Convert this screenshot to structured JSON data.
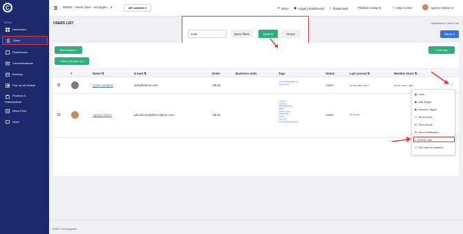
{
  "app": {
    "logo_letter": "C",
    "tenant_selector": "DEMO - Home Care - enCapptu... ▾",
    "admins_label": "MP ADMINS ▾",
    "inbox_label": "Inbox",
    "legacy_dashboard_label": "Legacy Dashboard",
    "downloads_label": "Downloads",
    "platform_setup_label": "Platform Setup ▾",
    "help_center_label": "Help Center",
    "user_label": "Agency Owner ▾"
  },
  "sidebar": {
    "menu_label": "MENU",
    "items": [
      {
        "label": "Dashboard",
        "icon": "dashboard-icon"
      },
      {
        "label": "Users",
        "icon": "user-icon"
      },
      {
        "label": "Experiences",
        "icon": "experiences-icon"
      },
      {
        "label": "Communications",
        "icon": "communications-icon"
      },
      {
        "label": "Booking",
        "icon": "booking-icon"
      },
      {
        "label": "Pop Up Ad Module",
        "icon": "popup-icon"
      },
      {
        "label": "Products &",
        "label2": "Subscriptions",
        "icon": "products-icon"
      },
      {
        "label": "News Feed",
        "icon": "news-icon"
      },
      {
        "label": "Inbox",
        "icon": "inbox-icon"
      }
    ]
  },
  "page": {
    "title": "USERS LIST",
    "breadcrumb": "Dashboard  /  Users List",
    "menu_button": "Menu ▾"
  },
  "filters": {
    "search_value": "Julia",
    "more_filters_label": "More filters",
    "search_button_label": "Search",
    "reset_button_label": "Reset"
  },
  "actions": {
    "bulk_actions_label": "Bulk actions ▾",
    "select_all_label": "Select All users (2)",
    "add_user_label": "+ Add user"
  },
  "table": {
    "headers": {
      "num": "#",
      "name": "Name ⇅",
      "email": "E-mail ⇅",
      "roles": "Roles",
      "business_units": "Business units",
      "tags": "Tags",
      "status": "Status",
      "last_access": "Last access ⇅",
      "member_since": "Member since ⇅"
    },
    "rows": [
      {
        "name": "Carla Caregiver",
        "email": "Julia@ra5-ez.com",
        "role": "Admin",
        "tags": [
          "ACTIVE CAREGIVER 2021",
          "Dallas Ground"
        ],
        "status": "Active",
        "last_access": "Jun 06, 2023 1:41pm",
        "member_since": "Aug 07, 2022 7:48pm"
      },
      {
        "name": "Agency Owner",
        "email": "julia.kennedy@encapture.com",
        "role": "Admin",
        "tags": [
          "Caregiver",
          "onboarding",
          "AgencyOwnerRMN",
          "Admin",
          "Active Caregiver",
          "Dallas Ground",
          "Kitchen",
          "Team One",
          "ACTIVE CAREGIVER 2021"
        ],
        "status": "Active",
        "last_access": "42 min ago",
        "member_since": "Apr 07, 2022 7:16pm"
      }
    ]
  },
  "dropdown": {
    "items": [
      {
        "label": "View",
        "icon": "eye-icon"
      },
      {
        "label": "Add Tag(s)",
        "icon": "tag-icon"
      },
      {
        "label": "Remove Tag(s)",
        "icon": "tag-remove-icon"
      },
      {
        "label": "Send Invite",
        "icon": "invite-icon"
      },
      {
        "label": "Send Email",
        "icon": "email-icon"
      },
      {
        "label": "Send Notification",
        "icon": "notification-icon"
      },
      {
        "label": "Delete User",
        "icon": "trash-icon"
      },
      {
        "label": "Set User as Inactive",
        "icon": "inactive-icon"
      }
    ]
  },
  "footer": {
    "text": "2025 © enCappture."
  },
  "colors": {
    "sidebar": "#1c2a6b",
    "accent_green": "#2ab27b",
    "accent_blue": "#3a6edb",
    "highlight_red": "#e53935"
  }
}
